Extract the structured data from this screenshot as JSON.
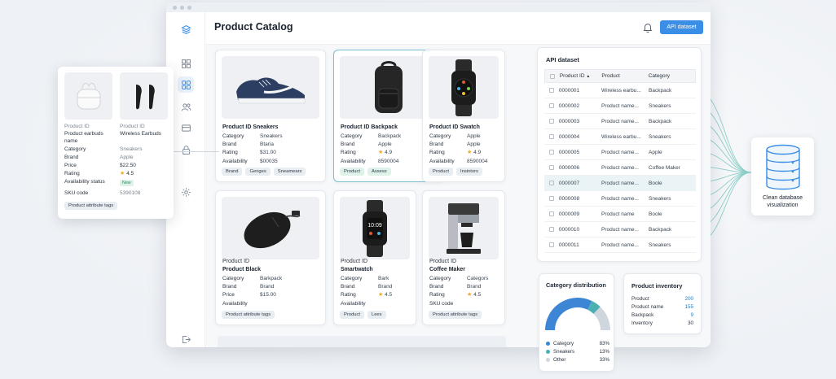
{
  "app": {
    "title": "Product Catalog",
    "api_button": "API dataset"
  },
  "sidebar": {
    "icons": [
      "layers-icon",
      "grid-icon",
      "dashboard-icon",
      "users-icon",
      "card-icon",
      "lock-icon",
      "settings-icon",
      "logout-icon"
    ]
  },
  "cards": [
    {
      "title": "Product ID Sneakers",
      "rows": [
        [
          "Category",
          "Sneakers"
        ],
        [
          "Brand",
          "Btaria"
        ],
        [
          "Rating",
          "$31.00"
        ],
        [
          "Availability",
          "$00035"
        ]
      ],
      "tags": [
        "Brand",
        "Genges",
        "Sneamears"
      ]
    },
    {
      "title": "Product ID Backpack",
      "rows": [
        [
          "Category",
          "Backpack"
        ],
        [
          "Brand",
          "Apple"
        ],
        [
          "Rating",
          "4.9"
        ],
        [
          "Availability",
          "8590004"
        ]
      ],
      "tags": [
        "Product",
        "Assess"
      ]
    },
    {
      "title": "Product ID Swatch",
      "rows": [
        [
          "Category",
          "Apple"
        ],
        [
          "Brand",
          "Apple"
        ],
        [
          "Rating",
          "4.9"
        ],
        [
          "Availability",
          "8590004"
        ]
      ],
      "tags": [
        "Product",
        "Insintors"
      ]
    },
    {
      "title_a": "Product ID",
      "title": "Product Black",
      "rows": [
        [
          "Category",
          "Barkpack"
        ],
        [
          "Brand",
          "Brand"
        ],
        [
          "Price",
          "$15.00"
        ],
        [
          "Availability",
          ""
        ]
      ],
      "tags": [
        "Product attribute tags"
      ]
    },
    {
      "title_a": "Product ID",
      "title": "Smartwatch",
      "rows": [
        [
          "Category",
          "Bark"
        ],
        [
          "Brand",
          "Brand"
        ],
        [
          "Rating",
          "4.5"
        ],
        [
          "Availability",
          ""
        ]
      ],
      "tags": [
        "Product",
        "Lees"
      ]
    },
    {
      "title_a": "Product ID",
      "title": "Coffee Maker",
      "rows": [
        [
          "Category",
          "Categors"
        ],
        [
          "Brand",
          "Brand"
        ],
        [
          "Rating",
          "4.5"
        ],
        [
          "SKU code",
          ""
        ]
      ],
      "tags": [
        "Product attribute tags"
      ]
    }
  ],
  "api_panel": {
    "title": "API dataset",
    "headers": [
      "Product ID",
      "Product",
      "Category"
    ],
    "rows": [
      [
        "0000001",
        "Wireless earbu...",
        "Backpack"
      ],
      [
        "0000002",
        "Product name...",
        "Sneakers"
      ],
      [
        "0000003",
        "Product name...",
        "Backpack"
      ],
      [
        "0000004",
        "Wireless earbu...",
        "Sneakers"
      ],
      [
        "0000005",
        "Product name...",
        "Apple"
      ],
      [
        "0000006",
        "Product name...",
        "Coffee Maker"
      ],
      [
        "0000007",
        "Product name...",
        "Boole"
      ],
      [
        "0000008",
        "Product name...",
        "Sneakers"
      ],
      [
        "0000009",
        "Product name",
        "Boole"
      ],
      [
        "0000010",
        "Product name...",
        "Backpack"
      ],
      [
        "0000011",
        "Product name...",
        "Sneakers"
      ]
    ]
  },
  "db": {
    "label_1": "Clean database",
    "label_2": "visualization"
  },
  "category_distribution": {
    "title": "Category distribution",
    "items": [
      {
        "name": "Category",
        "pct": "83%",
        "color": "#3d86d6"
      },
      {
        "name": "Sneakers",
        "pct": "13%",
        "color": "#4bb0b2"
      },
      {
        "name": "Other",
        "pct": "33%",
        "color": "#cfd6dd"
      }
    ],
    "values": [
      83,
      13,
      33
    ]
  },
  "inventory": {
    "title": "Product inventory",
    "rows": [
      [
        "Product",
        "200"
      ],
      [
        "Product name",
        "155"
      ],
      [
        "Backpack",
        "9"
      ],
      [
        "Inventory",
        "30"
      ]
    ]
  },
  "floating": {
    "left": {
      "id": "Product ID",
      "name": "Product earbuds name"
    },
    "right": {
      "id": "Product ID",
      "name": "Wireless Earbuds"
    },
    "rows": [
      [
        "Category",
        "Sneakers"
      ],
      [
        "Brand",
        "Apple"
      ],
      [
        "Price",
        "$22.50"
      ],
      [
        "Rating",
        "4.5"
      ],
      [
        "Availability status",
        "New"
      ],
      [
        "SKU code",
        "5390108"
      ]
    ],
    "tag": "Product attribute tags"
  }
}
